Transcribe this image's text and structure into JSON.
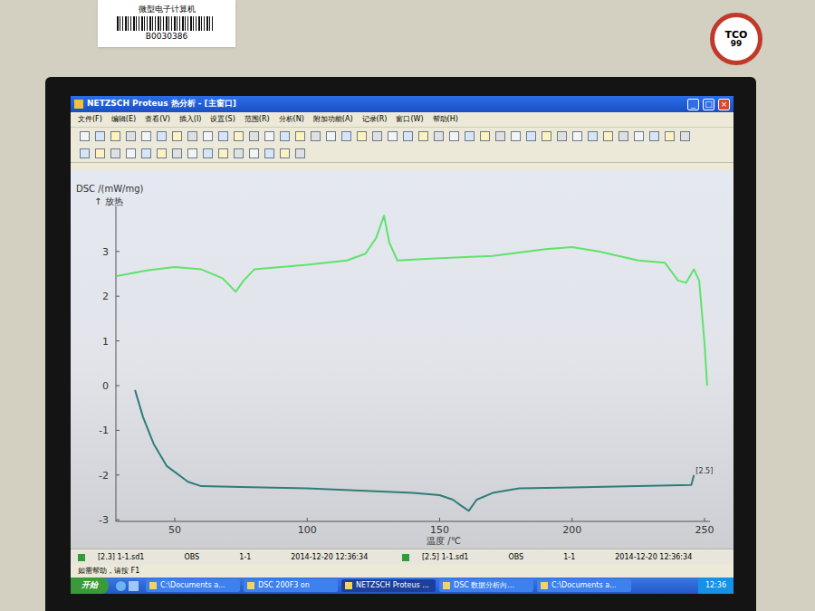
{
  "sticker": {
    "label": "微型电子计算机",
    "code": "B0030386"
  },
  "badge": {
    "top": "TCO",
    "bottom": "99"
  },
  "window": {
    "title": "NETZSCH Proteus 热分析 - [主窗口]",
    "controls": [
      "_",
      "□",
      "×"
    ]
  },
  "menu": [
    "文件(F)",
    "编辑(E)",
    "查看(V)",
    "插入(I)",
    "设置(S)",
    "范围(R)",
    "分析(N)",
    "附加功能(A)",
    "记录(R)",
    "窗口(W)",
    "帮助(H)"
  ],
  "chart": {
    "y_label": "DSC /(mW/mg)",
    "y_note": "↑ 放热",
    "y_ticks": [
      "3",
      "2",
      "1",
      "0",
      "-1",
      "-2",
      "-3"
    ],
    "x_ticks": [
      "50",
      "100",
      "150",
      "200",
      "250"
    ],
    "x_label": "温度 /℃",
    "series": [
      {
        "name": "upper",
        "color": "#5ee36a",
        "end_label": "",
        "x": [
          28,
          40,
          50,
          60,
          68,
          73,
          76,
          80,
          100,
          115,
          122,
          126,
          129,
          131,
          134,
          150,
          170,
          190,
          200,
          210,
          225,
          235,
          240,
          243,
          246,
          248,
          250,
          251
        ],
        "y": [
          2.45,
          2.58,
          2.65,
          2.6,
          2.4,
          2.1,
          2.35,
          2.6,
          2.7,
          2.8,
          2.95,
          3.3,
          3.8,
          3.2,
          2.8,
          2.85,
          2.9,
          3.05,
          3.1,
          3.0,
          2.8,
          2.75,
          2.35,
          2.3,
          2.6,
          2.35,
          0.95,
          0.0
        ]
      },
      {
        "name": "lower",
        "color": "#2e7d7a",
        "end_label": "[2.5]",
        "x": [
          35,
          38,
          42,
          47,
          55,
          60,
          100,
          140,
          150,
          155,
          158,
          161,
          164,
          170,
          180,
          200,
          245,
          246
        ],
        "y": [
          -0.1,
          -0.7,
          -1.3,
          -1.8,
          -2.15,
          -2.25,
          -2.3,
          -2.4,
          -2.45,
          -2.55,
          -2.68,
          -2.8,
          -2.55,
          -2.4,
          -2.3,
          -2.28,
          -2.22,
          -2.0
        ]
      }
    ]
  },
  "status_bar": [
    {
      "file": "[2.3] 1-1.sd1",
      "mode": "OBS",
      "segment": "1-1",
      "time": "2014-12-20 12:36:34",
      "color": "#2f9e3a"
    },
    {
      "file": "[2.5] 1-1.sd1",
      "mode": "OBS",
      "segment": "1-1",
      "time": "2014-12-20 12:36:34",
      "color": "#2f9e3a"
    }
  ],
  "help": "如需帮助，请按 F1",
  "taskbar": {
    "start": "开始",
    "tasks": [
      {
        "label": "C:\\Documents a...",
        "selected": false
      },
      {
        "label": "DSC 200F3 on",
        "selected": false
      },
      {
        "label": "NETZSCH Proteus ...",
        "selected": true
      },
      {
        "label": "DSC 数据分析向...",
        "selected": false
      },
      {
        "label": "C:\\Documents a...",
        "selected": false
      }
    ],
    "clock": "12:36"
  }
}
